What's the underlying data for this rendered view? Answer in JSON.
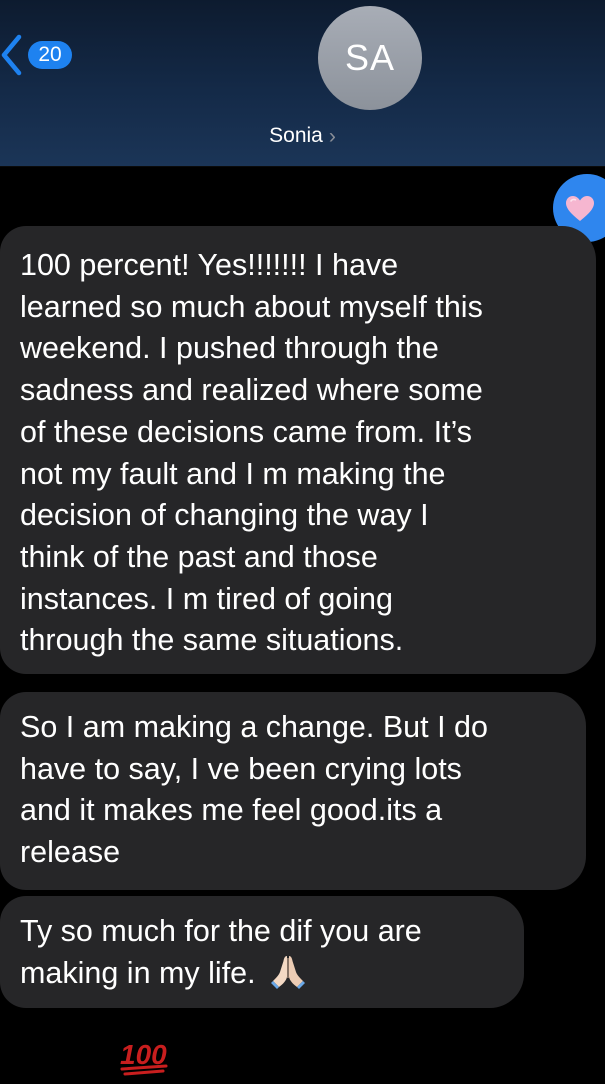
{
  "header": {
    "back_count": "20",
    "avatar_initials": "SA",
    "contact_name": "Sonia",
    "chevron": "›"
  },
  "reaction": {
    "icon": "heart-icon",
    "bubble_color": "#2f86ee",
    "heart_color": "#f6b6d0"
  },
  "messages": [
    {
      "lines": [
        "100 percent! Yes!!!!!!! I have",
        "learned so much about myself this",
        "weekend. I pushed through the",
        "sadness and realized where some",
        "of these decisions came from. It’s",
        "not my fault and I m making the",
        "decision of changing the way I",
        "think of the past and those",
        "instances. I m tired of going",
        "through the same situations."
      ]
    },
    {
      "lines": [
        "So I am making a change. But I do",
        "have to say, I ve been crying lots",
        "and it makes me feel good.its a",
        "release"
      ]
    },
    {
      "lines": [
        "Ty so much for the dif you are",
        "making in my life."
      ],
      "emoji": "folded-hands-icon"
    }
  ],
  "footer_emoji": {
    "icon": "hundred-points-icon",
    "text": "100"
  },
  "colors": {
    "accent": "#1e82f0",
    "bubble": "#262628",
    "background": "#000000"
  }
}
